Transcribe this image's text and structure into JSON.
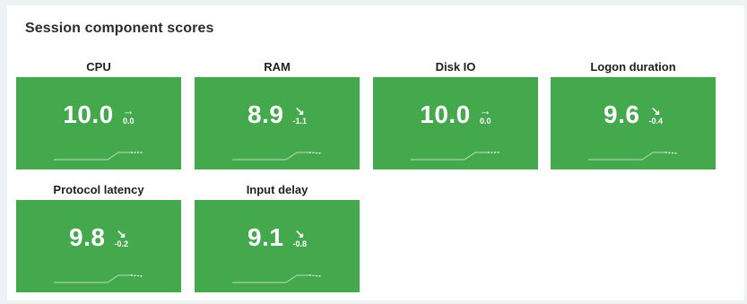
{
  "panel": {
    "title": "Session component scores"
  },
  "tiles": [
    {
      "label": "CPU",
      "score": "10.0",
      "arrow": "→",
      "arrow_icon": "arrow-right-icon",
      "delta": "0.0"
    },
    {
      "label": "RAM",
      "score": "8.9",
      "arrow": "↘",
      "arrow_icon": "arrow-down-right-icon",
      "delta": "-1.1"
    },
    {
      "label": "Disk IO",
      "score": "10.0",
      "arrow": "→",
      "arrow_icon": "arrow-right-icon",
      "delta": "0.0"
    },
    {
      "label": "Logon duration",
      "score": "9.6",
      "arrow": "↘",
      "arrow_icon": "arrow-down-right-icon",
      "delta": "-0.4"
    },
    {
      "label": "Protocol latency",
      "score": "9.8",
      "arrow": "↘",
      "arrow_icon": "arrow-down-right-icon",
      "delta": "-0.2"
    },
    {
      "label": "Input delay",
      "score": "9.1",
      "arrow": "↘",
      "arrow_icon": "arrow-down-right-icon",
      "delta": "-0.8"
    }
  ],
  "colors": {
    "tile_bg": "#44a84c",
    "text_on_tile": "#ffffff"
  }
}
